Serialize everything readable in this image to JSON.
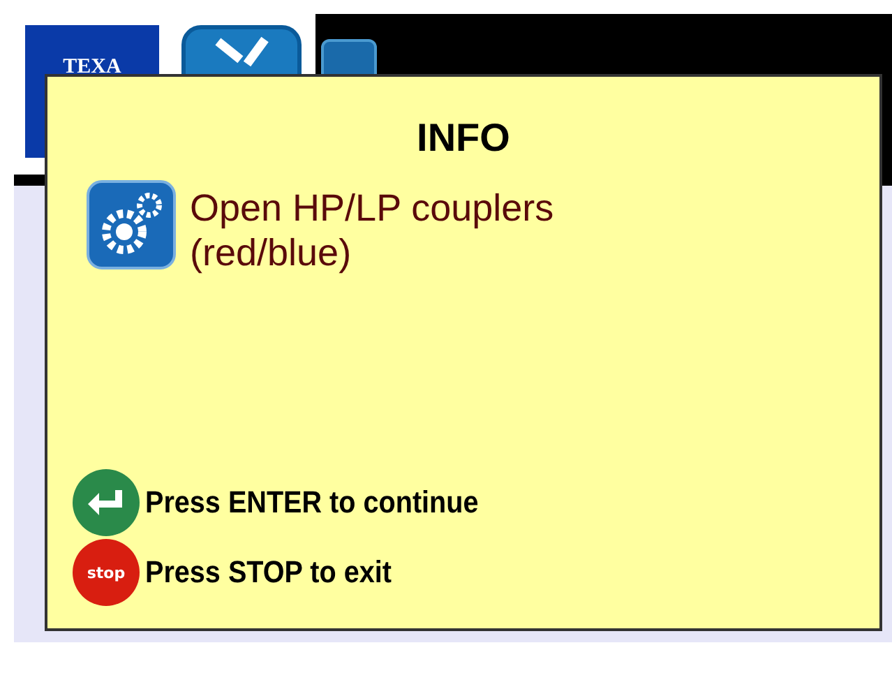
{
  "header": {
    "logo": "TEXA"
  },
  "dialog": {
    "title": "INFO",
    "message_lines": [
      "Open HP/LP couplers",
      "(red/blue)"
    ],
    "actions": [
      {
        "kind": "enter",
        "label": "Press ENTER to continue"
      },
      {
        "kind": "stop",
        "icon_text": "stop",
        "label": "Press STOP to exit"
      }
    ]
  }
}
